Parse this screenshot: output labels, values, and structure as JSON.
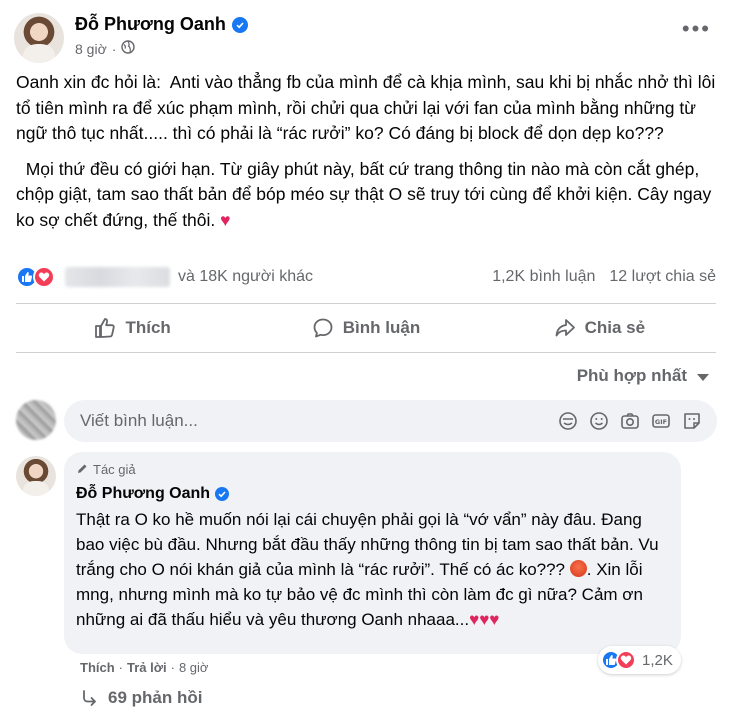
{
  "post": {
    "author": "Đỗ Phương Oanh",
    "time": "8 giờ",
    "more": "•••",
    "paragraphs": [
      "Oanh xin đc hỏi là:  Anti vào thẳng fb của mình để cà khịa mình, sau khi bị nhắc nhở thì lôi tổ tiên mình ra để xúc phạm mình, rồi chửi qua chửi lại với fan của mình bằng những từ ngữ thô tục nhất..... thì có phải là “rác rưởi” ko? Có đáng bị block để dọn dẹp ko???",
      "  Mọi thứ đều có giới hạn. Từ giây phút này, bất cứ trang thông tin nào mà còn cắt ghép, chộp giật, tam sao thất bản để bóp méo sự thật O sẽ truy tới cùng để khởi kiện. Cây ngay ko sợ chết đứng, thế thôi. "
    ],
    "heart": "♥",
    "others": "và 18K người khác",
    "comments_count": "1,2K bình luận",
    "shares_count": "12 lượt chia sẻ"
  },
  "actions": {
    "like": "Thích",
    "comment": "Bình luận",
    "share": "Chia sẻ"
  },
  "sort": {
    "label": "Phù hợp nhất"
  },
  "comment_box": {
    "placeholder": "Viết bình luận..."
  },
  "comment": {
    "badge": "Tác giả",
    "author": "Đỗ Phương Oanh",
    "text_part1": "Thật ra O ko hề muốn nói lại cái chuyện phải gọi là “vớ vẩn” này đâu. Đang bao việc bù đầu. Nhưng bắt đầu thấy những thông tin bị tam sao thất bản. Vu trắng cho O nói khán giả của mình là “rác rưởi”. Thế có ác ko??? ",
    "text_part2": ". Xin lỗi mng, nhưng mình mà ko tự bảo vệ đc mình thì còn làm đc gì nữa? Cảm ơn những ai đã thấu hiểu và yêu thương Oanh nhaaa...",
    "hearts": "♥♥♥",
    "reaction_count": "1,2K",
    "like": "Thích",
    "dot": "·",
    "reply": "Trả lời",
    "time": "8 giờ",
    "replies": "69 phản hồi"
  },
  "colors": {
    "accent": "#1877f2",
    "love": "#f33e58",
    "secondary_text": "#65676b",
    "input_bg": "#f0f2f5"
  },
  "icons": [
    "verified-icon",
    "globe-icon",
    "like-reaction-icon",
    "love-reaction-icon",
    "thumbs-up-icon",
    "comment-icon",
    "share-icon",
    "sticker-icon",
    "emoji-icon",
    "camera-icon",
    "gif-icon",
    "sticker-pack-icon",
    "pen-icon",
    "reply-arrow-icon"
  ]
}
